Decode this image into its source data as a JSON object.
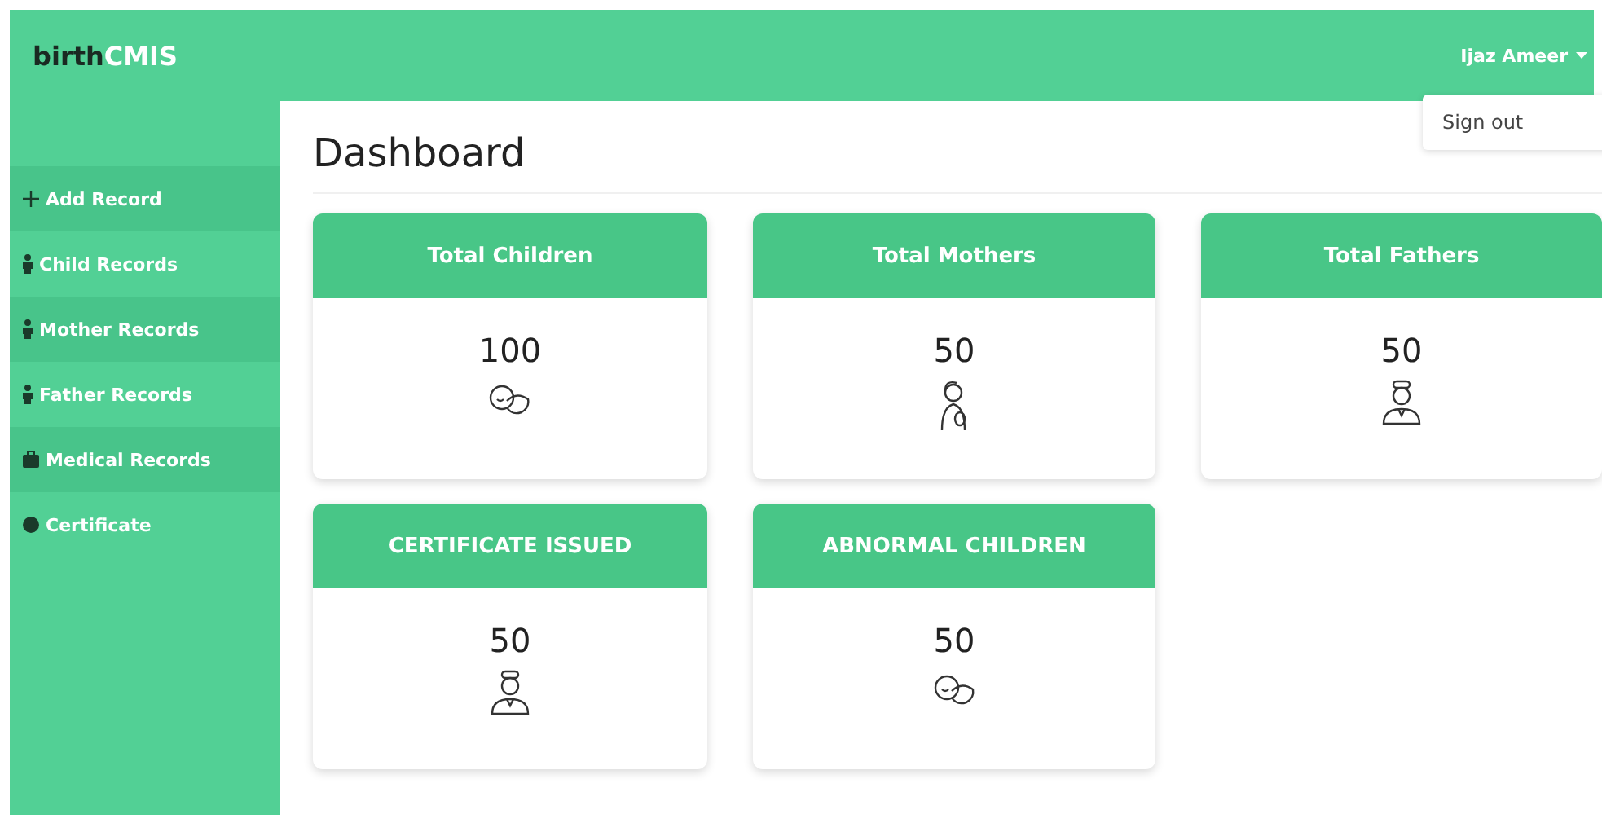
{
  "brand": {
    "first": "birth",
    "second": "CMIS"
  },
  "user_menu": {
    "name": "Ijaz Ameer",
    "expanded": true,
    "items": [
      "Sign out"
    ]
  },
  "sidebar": {
    "items": [
      {
        "label": "Add Record",
        "kind": "plus"
      },
      {
        "label": "Child Records",
        "kind": "person"
      },
      {
        "label": "Mother Records",
        "kind": "person"
      },
      {
        "label": "Father Records",
        "kind": "person"
      },
      {
        "label": "Medical Records",
        "kind": "kit"
      },
      {
        "label": "Certificate",
        "kind": "dot"
      }
    ]
  },
  "page_title": "Dashboard",
  "cards": [
    {
      "title": "Total Children",
      "value": "100",
      "kind": "baby"
    },
    {
      "title": "Total Mothers",
      "value": "50",
      "kind": "mother"
    },
    {
      "title": "Total Fathers",
      "value": "50",
      "kind": "father"
    },
    {
      "title": "CERTIFICATE ISSUED",
      "value": "50",
      "kind": "father"
    },
    {
      "title": "ABNORMAL CHILDREN",
      "value": "50",
      "kind": "baby"
    }
  ]
}
